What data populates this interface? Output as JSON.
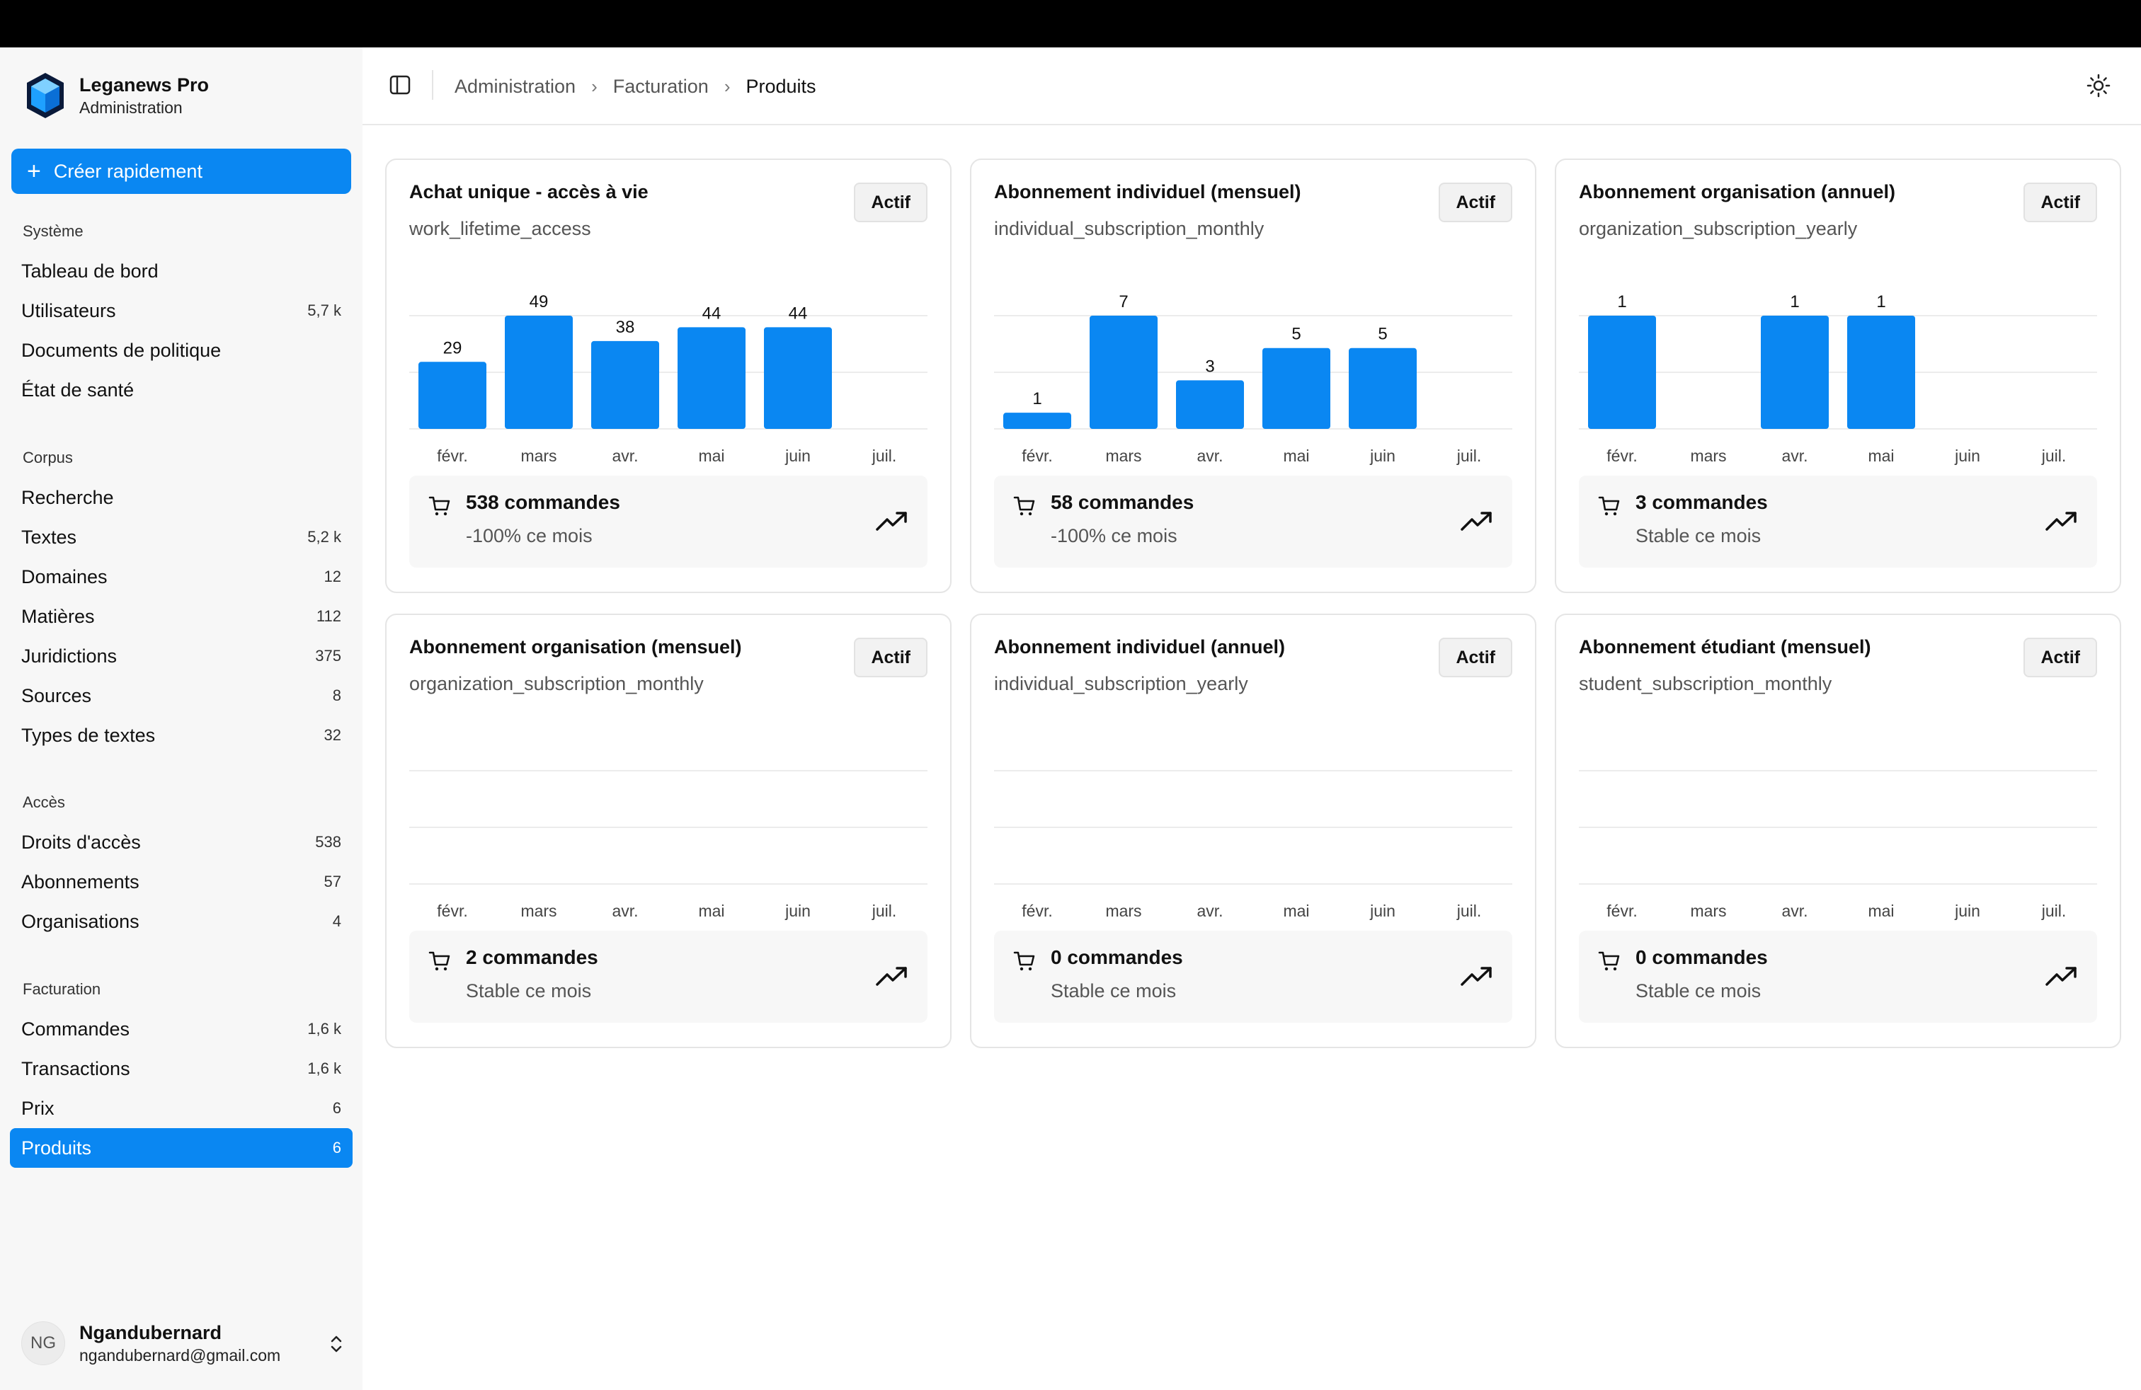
{
  "app": {
    "name": "Leganews Pro",
    "subtitle": "Administration",
    "accent_color": "#0a87f2"
  },
  "sidebar": {
    "quick_create": "Créer rapidement",
    "sections": [
      {
        "heading": "Système",
        "items": [
          {
            "label": "Tableau de bord",
            "count": ""
          },
          {
            "label": "Utilisateurs",
            "count": "5,7 k"
          },
          {
            "label": "Documents de politique",
            "count": ""
          },
          {
            "label": "État de santé",
            "count": ""
          }
        ]
      },
      {
        "heading": "Corpus",
        "items": [
          {
            "label": "Recherche",
            "count": ""
          },
          {
            "label": "Textes",
            "count": "5,2 k"
          },
          {
            "label": "Domaines",
            "count": "12"
          },
          {
            "label": "Matières",
            "count": "112"
          },
          {
            "label": "Juridictions",
            "count": "375"
          },
          {
            "label": "Sources",
            "count": "8"
          },
          {
            "label": "Types de textes",
            "count": "32"
          }
        ]
      },
      {
        "heading": "Accès",
        "items": [
          {
            "label": "Droits d'accès",
            "count": "538"
          },
          {
            "label": "Abonnements",
            "count": "57"
          },
          {
            "label": "Organisations",
            "count": "4"
          }
        ]
      },
      {
        "heading": "Facturation",
        "items": [
          {
            "label": "Commandes",
            "count": "1,6 k"
          },
          {
            "label": "Transactions",
            "count": "1,6 k"
          },
          {
            "label": "Prix",
            "count": "6"
          },
          {
            "label": "Produits",
            "count": "6",
            "active": true
          }
        ]
      }
    ],
    "user": {
      "initials": "NG",
      "name": "Ngandubernard",
      "email": "ngandubernard@gmail.com"
    }
  },
  "header": {
    "breadcrumb": [
      "Administration",
      "Facturation",
      "Produits"
    ]
  },
  "products": [
    {
      "title": "Achat unique - accès à vie",
      "code": "work_lifetime_access",
      "status": "Actif",
      "orders": "538 commandes",
      "trend": "-100% ce mois",
      "chart_data": {
        "type": "bar",
        "categories": [
          "févr.",
          "mars",
          "avr.",
          "mai",
          "juin",
          "juil."
        ],
        "values": [
          29,
          49,
          38,
          44,
          44,
          null
        ]
      }
    },
    {
      "title": "Abonnement individuel (mensuel)",
      "code": "individual_subscription_monthly",
      "status": "Actif",
      "orders": "58 commandes",
      "trend": "-100% ce mois",
      "chart_data": {
        "type": "bar",
        "categories": [
          "févr.",
          "mars",
          "avr.",
          "mai",
          "juin",
          "juil."
        ],
        "values": [
          1,
          7,
          3,
          5,
          5,
          null
        ]
      }
    },
    {
      "title": "Abonnement organisation (annuel)",
      "code": "organization_subscription_yearly",
      "status": "Actif",
      "orders": "3 commandes",
      "trend": "Stable ce mois",
      "chart_data": {
        "type": "bar",
        "categories": [
          "févr.",
          "mars",
          "avr.",
          "mai",
          "juin",
          "juil."
        ],
        "values": [
          1,
          null,
          1,
          1,
          null,
          null
        ]
      }
    },
    {
      "title": "Abonnement organisation (mensuel)",
      "code": "organization_subscription_monthly",
      "status": "Actif",
      "orders": "2 commandes",
      "trend": "Stable ce mois",
      "chart_data": {
        "type": "bar",
        "categories": [
          "févr.",
          "mars",
          "avr.",
          "mai",
          "juin",
          "juil."
        ],
        "values": [
          null,
          null,
          null,
          null,
          null,
          null
        ]
      }
    },
    {
      "title": "Abonnement individuel (annuel)",
      "code": "individual_subscription_yearly",
      "status": "Actif",
      "orders": "0 commandes",
      "trend": "Stable ce mois",
      "chart_data": {
        "type": "bar",
        "categories": [
          "févr.",
          "mars",
          "avr.",
          "mai",
          "juin",
          "juil."
        ],
        "values": [
          null,
          null,
          null,
          null,
          null,
          null
        ]
      }
    },
    {
      "title": "Abonnement étudiant (mensuel)",
      "code": "student_subscription_monthly",
      "status": "Actif",
      "orders": "0 commandes",
      "trend": "Stable ce mois",
      "chart_data": {
        "type": "bar",
        "categories": [
          "févr.",
          "mars",
          "avr.",
          "mai",
          "juin",
          "juil."
        ],
        "values": [
          null,
          null,
          null,
          null,
          null,
          null
        ]
      }
    }
  ]
}
